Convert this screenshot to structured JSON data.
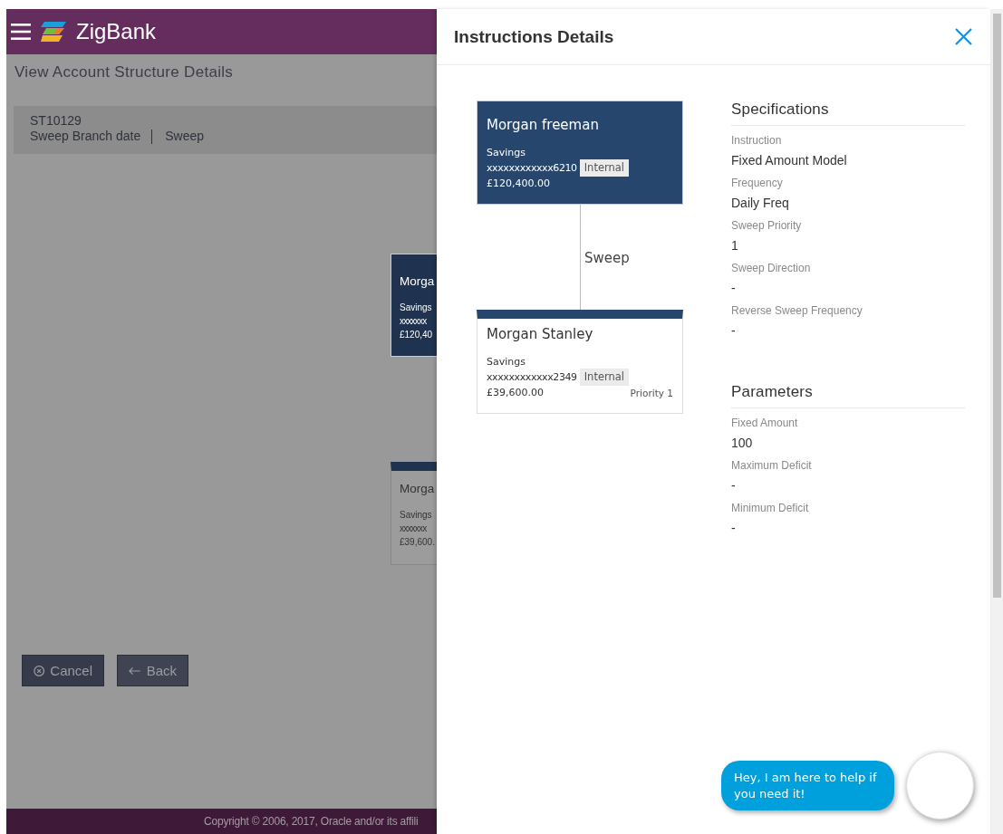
{
  "header": {
    "brand": "ZigBank"
  },
  "page": {
    "title": "View Account Structure Details",
    "structure": {
      "id": "ST10129",
      "name": "Sweep Branch date",
      "type": "Sweep"
    }
  },
  "background_nodes": [
    {
      "kind": "parent",
      "name": "Morga",
      "account_type": "Savings",
      "account_number": "xxxxxxx",
      "balance": "£120,40"
    },
    {
      "kind": "child",
      "name": "Morga",
      "account_type": "Savings",
      "account_number": "xxxxxxx",
      "balance": "£39,600."
    }
  ],
  "buttons": [
    {
      "kind": "cancel",
      "label": "Cancel"
    },
    {
      "kind": "back",
      "label": "Back"
    }
  ],
  "footer": {
    "copyright": "Copyright © 2006, 2017, Oracle and/or its affili"
  },
  "drawer": {
    "title": "Instructions Details",
    "nodes": [
      {
        "kind": "parent",
        "name": "Morgan freeman",
        "account_type": "Savings",
        "account_number": "xxxxxxxxxxxx6210",
        "tag": "Internal",
        "balance": "£120,400.00"
      },
      {
        "kind": "child",
        "name": "Morgan Stanley",
        "account_type": "Savings",
        "account_number": "xxxxxxxxxxxx2349",
        "tag": "Internal",
        "balance": "£39,600.00",
        "priority": "Priority 1"
      }
    ],
    "link_label": "Sweep",
    "sections": [
      {
        "title": "Specifications",
        "fields": [
          {
            "label": "Instruction",
            "value": "Fixed Amount Model"
          },
          {
            "label": "Frequency",
            "value": "Daily Freq"
          },
          {
            "label": "Sweep Priority",
            "value": "1"
          },
          {
            "label": "Sweep Direction",
            "value": "-"
          },
          {
            "label": "Reverse Sweep Frequency",
            "value": "-"
          }
        ]
      },
      {
        "title": "Parameters",
        "fields": [
          {
            "label": "Fixed Amount",
            "value": "100"
          },
          {
            "label": "Maximum Deficit",
            "value": "-"
          },
          {
            "label": "Minimum Deficit",
            "value": "-"
          }
        ]
      }
    ]
  },
  "chat": {
    "message": "Hey, I am here to help if you need it!"
  }
}
